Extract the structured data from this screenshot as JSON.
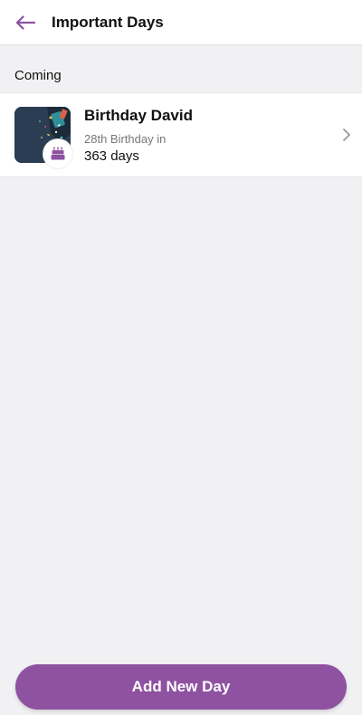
{
  "header": {
    "title": "Important Days",
    "back_icon": "arrow-left-icon",
    "accent_color": "#8e52a1"
  },
  "section": {
    "label": "Coming"
  },
  "items": [
    {
      "title": "Birthday David",
      "subtitle": "28th Birthday in",
      "days": "363 days",
      "badge_icon": "birthday-cake-icon",
      "thumbnail": "party-photo",
      "chevron_icon": "chevron-right-icon"
    }
  ],
  "footer": {
    "add_label": "Add New Day",
    "button_color": "#8e52a1"
  }
}
